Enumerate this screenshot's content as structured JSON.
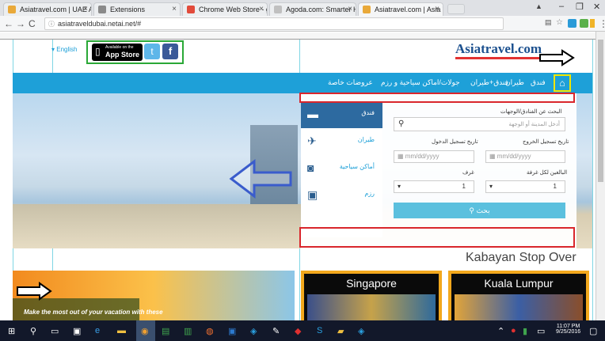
{
  "tabs": [
    {
      "title": "Asiatravel.com | UAE Asi",
      "icon_color": "#e9a93a",
      "active": false
    },
    {
      "title": "Extensions",
      "icon_color": "#8a8a8a",
      "active": false
    },
    {
      "title": "Chrome Web Store - gri",
      "icon_color": "#e24b3b",
      "active": false
    },
    {
      "title": "Agoda.com: Smarter Ho",
      "icon_color": "#c0c0c0",
      "active": false
    },
    {
      "title": "Asiatravel.com | Asia Tra",
      "icon_color": "#e9a93a",
      "active": true
    }
  ],
  "address": {
    "url": "asiatraveldubai.netai.net/#"
  },
  "header": {
    "language": "English",
    "app_store_small": "Available on the",
    "app_store": "App Store",
    "logo": "Asiatravel.com"
  },
  "nav": {
    "items": [
      "فندق",
      "طيران",
      "فندق+طيران",
      "جولات/اماكن سياحية و رزم",
      "عروضات خاصة"
    ]
  },
  "search": {
    "tabs": [
      "فندق",
      "طيران",
      "أماكن سياحية",
      "رزم"
    ],
    "dest_label": "البحث عن الفنادق/الوجهات",
    "dest_placeholder": "أدخل المدينة أو الوجهة",
    "checkin_label": "تاريخ تسجيل الدخول",
    "checkout_label": "تاريخ تسجيل الخروج",
    "checkin_placeholder": "mm/dd/yyyy",
    "checkout_placeholder": "mm/dd/yyyy",
    "rooms_label": "غرف",
    "adults_label": "البالغين لكل غرفة",
    "rooms_value": "1",
    "adults_value": "1",
    "search_button": "بحث"
  },
  "caption": "Kabayan Stop Over",
  "promos": [
    "Singapore",
    "Kuala Lumpur"
  ],
  "promo_text": "Make the most out of your vacation with these",
  "taskbar": {
    "time": "11:07 PM",
    "date": "9/25/2016"
  },
  "colors": {
    "accent": "#1ea0d8",
    "annotation_red": "#d9262c",
    "annotation_green": "#2aa836",
    "annotation_yellow": "#f2e600"
  }
}
